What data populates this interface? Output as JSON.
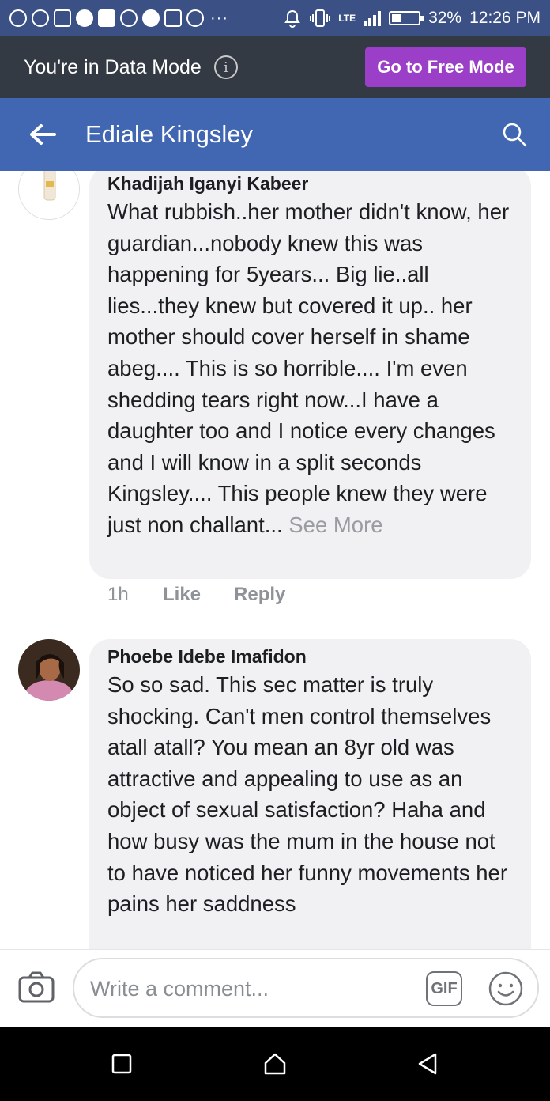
{
  "status_bar": {
    "battery": "32%",
    "time": "12:26 PM",
    "network": "LTE",
    "battery_level": 0.32,
    "notification_icons": [
      "opera-mini-icon",
      "whatsapp-icon",
      "gmail-icon",
      "messenger-icon",
      "facebook-icon",
      "chrome-icon",
      "facebook-icon",
      "tshirt-icon",
      "shield-icon"
    ],
    "more": "···"
  },
  "data_mode": {
    "message": "You're in Data Mode",
    "button_label": "Go to Free Mode"
  },
  "header": {
    "title": "Ediale Kingsley"
  },
  "comments": [
    {
      "author": "Khadijah Iganyi Kabeer",
      "text": "What rubbish..her mother didn't know, her guardian...nobody knew this was happening for 5years... Big lie..all lies...they knew but covered it up..  her mother should cover herself in shame abeg.... This is so horrible.... I'm even shedding tears right now...I have a daughter too and I notice every changes and I will know in a split seconds Kingsley.... This people knew they were just non challant...",
      "see_more": "See More",
      "time": "1h",
      "like": "Like",
      "reply": "Reply"
    },
    {
      "author": "Phoebe Idebe Imafidon",
      "text": "So so sad.  This sec matter is truly shocking. Can't men control themselves atall atall? You mean an 8yr old was attractive and appealing to use as an object of sexual satisfaction? Haha and how busy was the mum in the house not to have noticed her funny movements her pains her saddness"
    }
  ],
  "comment_bar": {
    "placeholder": "Write a comment...",
    "gif_label": "GIF"
  },
  "colors": {
    "status_bar": "#3b5186",
    "data_bar": "#343a43",
    "free_mode_button": "#9b3fc8",
    "header": "#4267b2",
    "bubble": "#f1f1f3"
  }
}
